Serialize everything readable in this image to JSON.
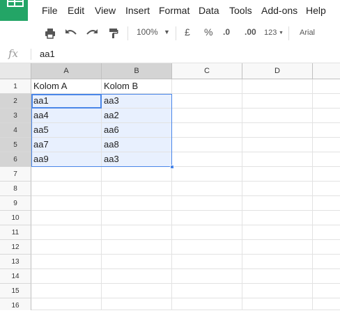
{
  "menu": [
    "File",
    "Edit",
    "View",
    "Insert",
    "Format",
    "Data",
    "Tools",
    "Add-ons",
    "Help"
  ],
  "toolbar": {
    "zoom": "100%",
    "currency": "£",
    "percent": "%",
    "dec_less": ".0",
    "dec_more": ".00",
    "more_formats": "123",
    "font": "Arial"
  },
  "formula_bar": {
    "fx": "fx",
    "value": "aa1"
  },
  "columns": [
    "A",
    "B",
    "C",
    "D"
  ],
  "rows": [
    "1",
    "2",
    "3",
    "4",
    "5",
    "6",
    "7",
    "8",
    "9",
    "10",
    "11",
    "12",
    "13",
    "14",
    "15",
    "16"
  ],
  "cells": {
    "A1": "Kolom A",
    "B1": "Kolom B",
    "A2": "aa1",
    "B2": "aa3",
    "A3": "aa4",
    "B3": "aa2",
    "A4": "aa5",
    "B4": "aa6",
    "A5": "aa7",
    "B5": "aa8",
    "A6": "aa9",
    "B6": "aa3"
  },
  "colors": {
    "accent": "#4a86e8",
    "sheets_green": "#23a566",
    "selection_fill": "#e8f0fe"
  }
}
